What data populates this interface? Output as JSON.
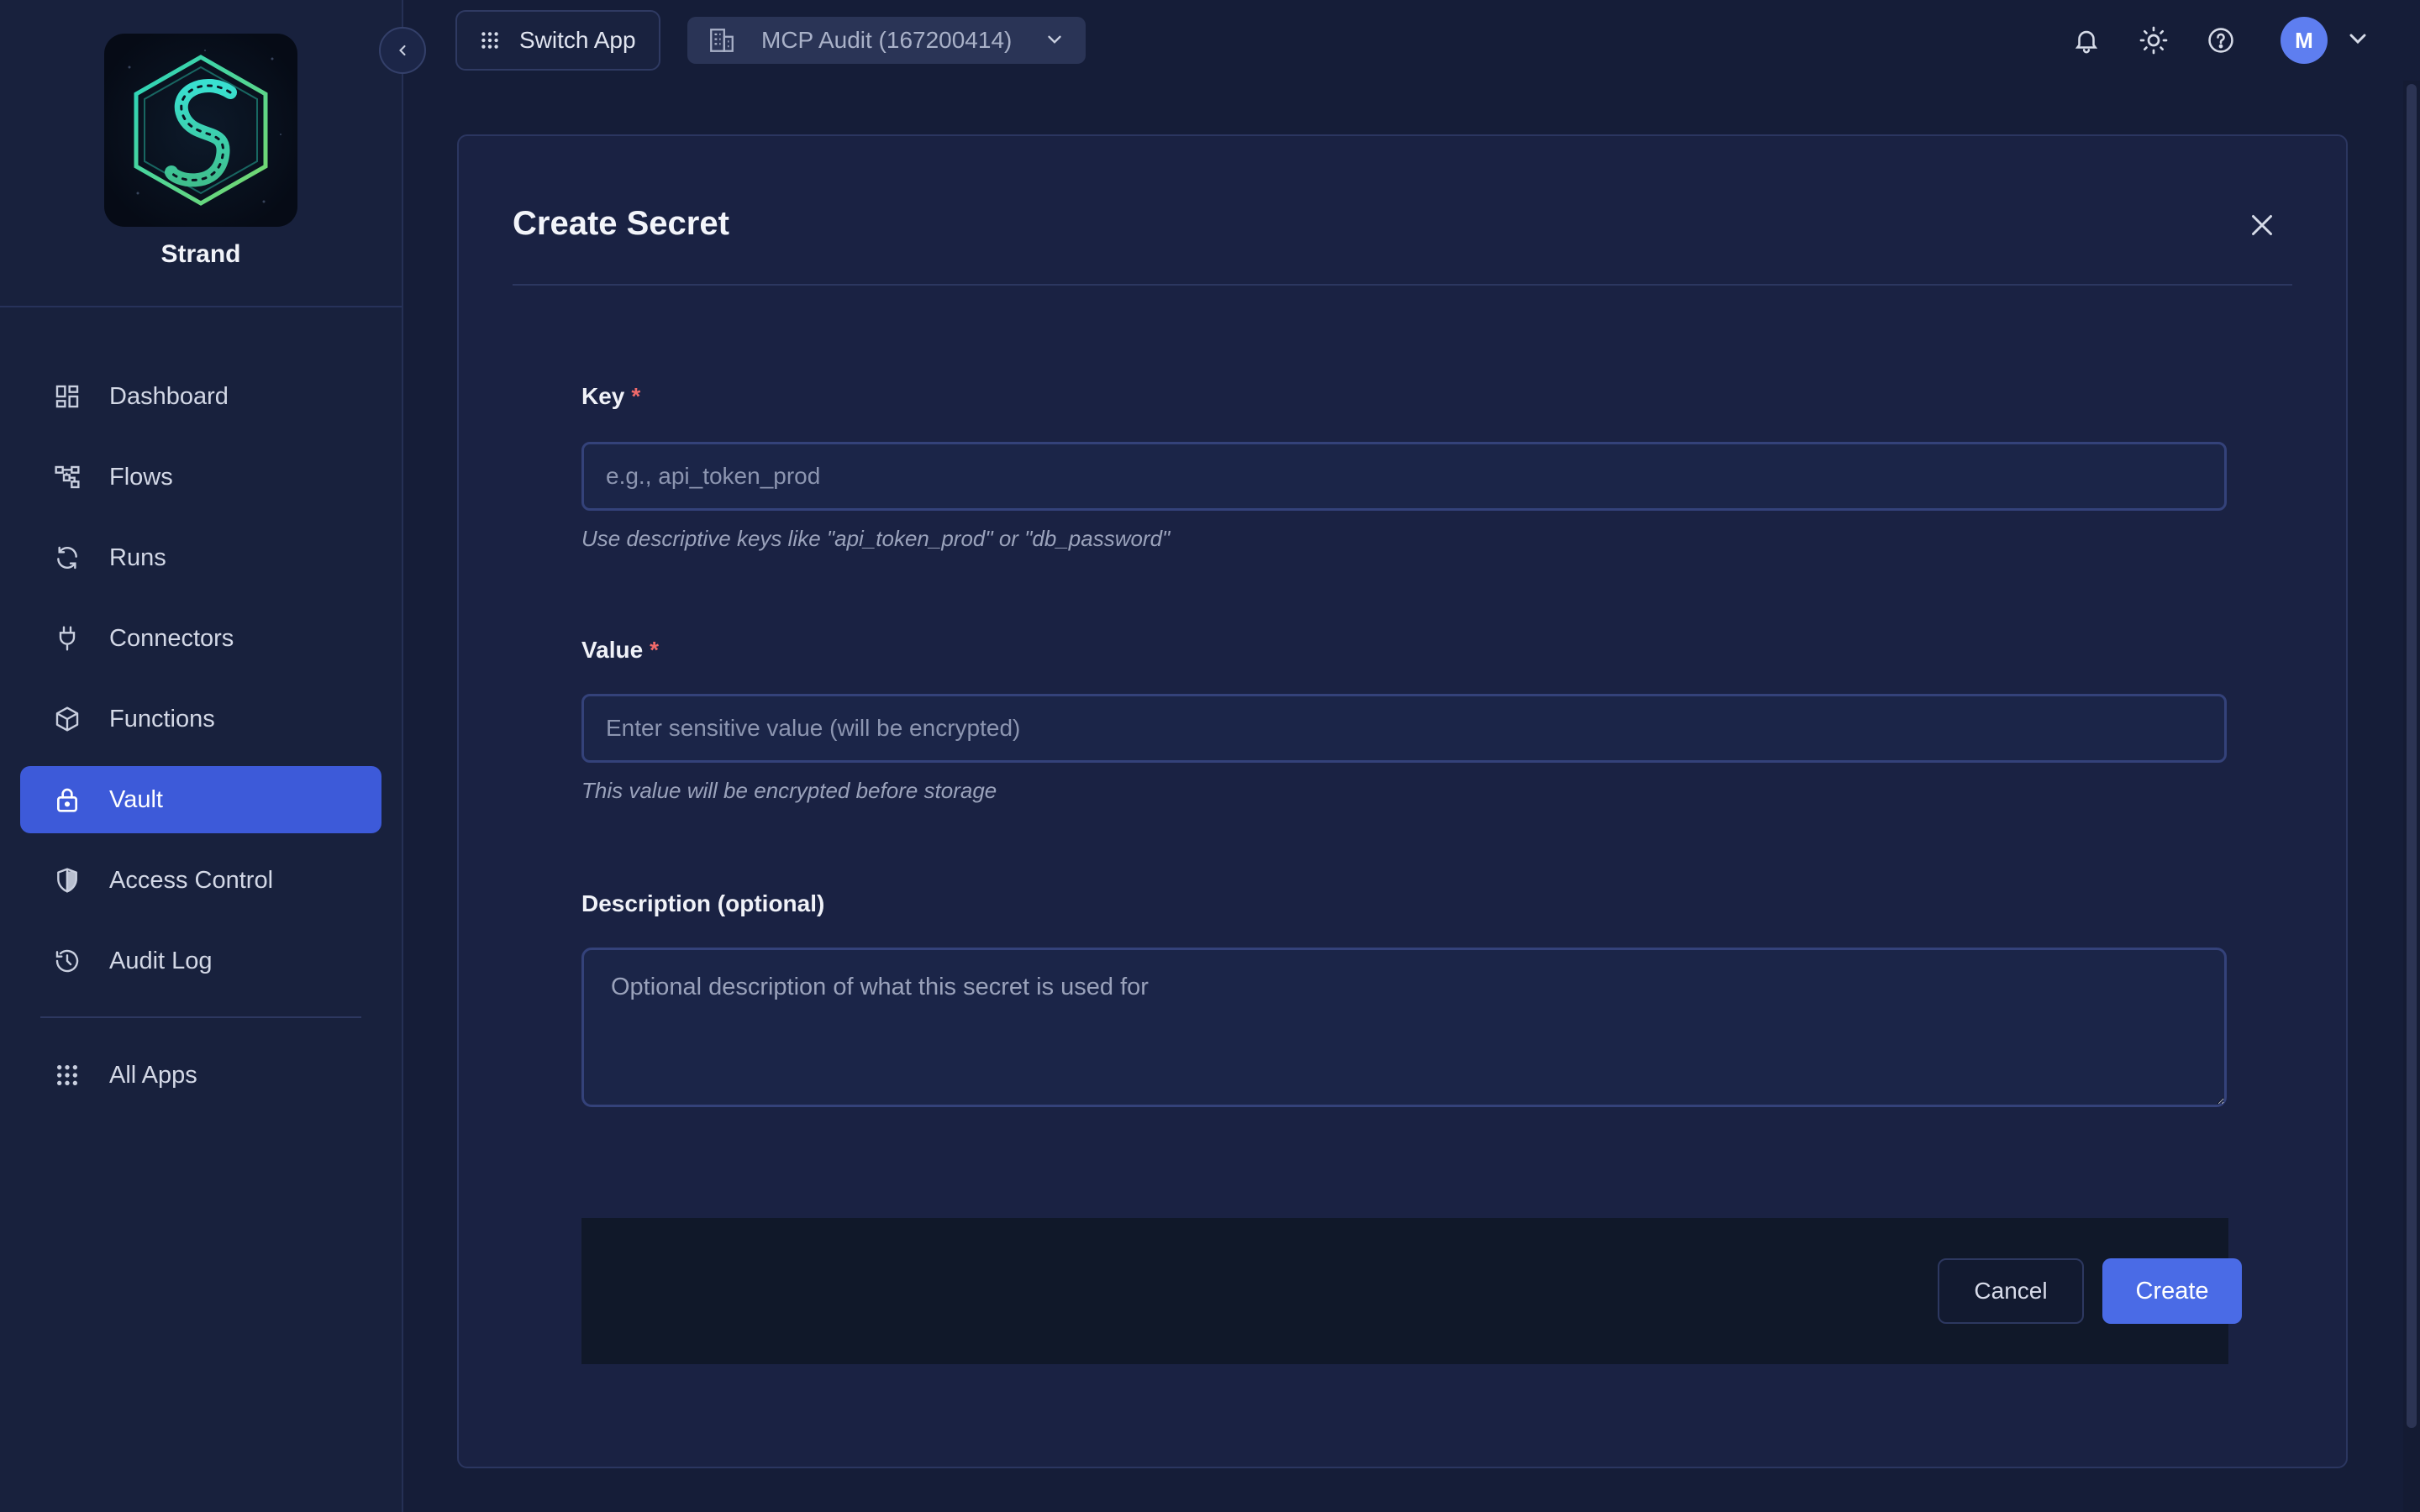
{
  "app": {
    "name": "Strand"
  },
  "sidebar": {
    "items": [
      {
        "label": "Dashboard",
        "icon": "dashboard-icon"
      },
      {
        "label": "Flows",
        "icon": "flows-icon"
      },
      {
        "label": "Runs",
        "icon": "runs-icon"
      },
      {
        "label": "Connectors",
        "icon": "plug-icon"
      },
      {
        "label": "Functions",
        "icon": "cube-icon"
      },
      {
        "label": "Vault",
        "icon": "lock-icon",
        "active": true
      },
      {
        "label": "Access Control",
        "icon": "shield-icon"
      },
      {
        "label": "Audit Log",
        "icon": "history-icon"
      }
    ],
    "all_apps": {
      "label": "All Apps",
      "icon": "grid-icon"
    }
  },
  "topbar": {
    "switch_app": "Switch App",
    "org": "MCP Audit (167200414)",
    "avatar_initial": "M"
  },
  "modal": {
    "title": "Create Secret",
    "key": {
      "label": "Key",
      "required": "*",
      "placeholder": "e.g., api_token_prod",
      "value": "",
      "hint": "Use descriptive keys like \"api_token_prod\" or \"db_password\""
    },
    "value": {
      "label": "Value",
      "required": "*",
      "placeholder": "Enter sensitive value (will be encrypted)",
      "value": "",
      "hint": "This value will be encrypted before storage"
    },
    "description": {
      "label": "Description (optional)",
      "placeholder": "Optional description of what this secret is used for",
      "value": ""
    },
    "cancel_label": "Cancel",
    "create_label": "Create"
  },
  "colors": {
    "background": "#151d38",
    "sidebar": "#18213d",
    "accent": "#3d5ad9",
    "primary_button": "#4a6be6",
    "required": "#f06a6a"
  }
}
